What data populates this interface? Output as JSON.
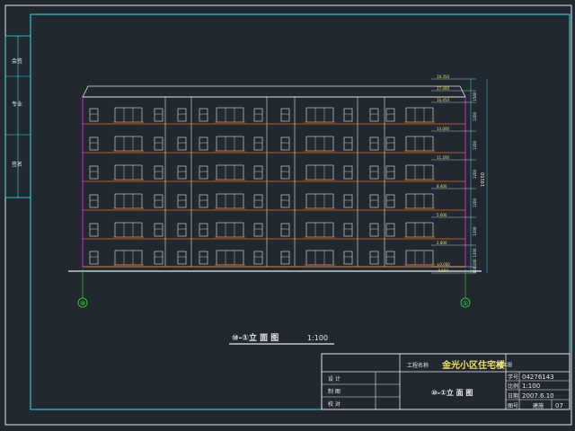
{
  "drawing": {
    "title": "⑩-①立 面 图",
    "scale": "1:100",
    "total_height_dim": "19150"
  },
  "title_block": {
    "project_label": "工程名称",
    "project_name": "金光小区住宅楼",
    "project_suffix": "施工图",
    "sheet_title": "⑩-①立 面 图",
    "row_labels": [
      "设 计",
      "制 图",
      "校 对"
    ],
    "id_label": "学号",
    "id_value": "04276143",
    "scale_label": "比例",
    "scale_value": "1:100",
    "date_label": "日期",
    "date_value": "2007.6.10",
    "sheet_label": "图号",
    "sheet_sub": "建施",
    "sheet_no": "07"
  },
  "axes": {
    "left": "⑩",
    "right": "①"
  },
  "level_labels": [
    "19.350",
    "17.400",
    "16.450",
    "14.000",
    "11.200",
    "8.400",
    "5.600",
    "2.800",
    "±0.000",
    "-0.600"
  ],
  "floor_dims": [
    "1500",
    "1200",
    "1200",
    "1200",
    "1200",
    "1200",
    "1200",
    "1200",
    "600"
  ],
  "side_labels": [
    "会签",
    "专业",
    "签名"
  ]
}
